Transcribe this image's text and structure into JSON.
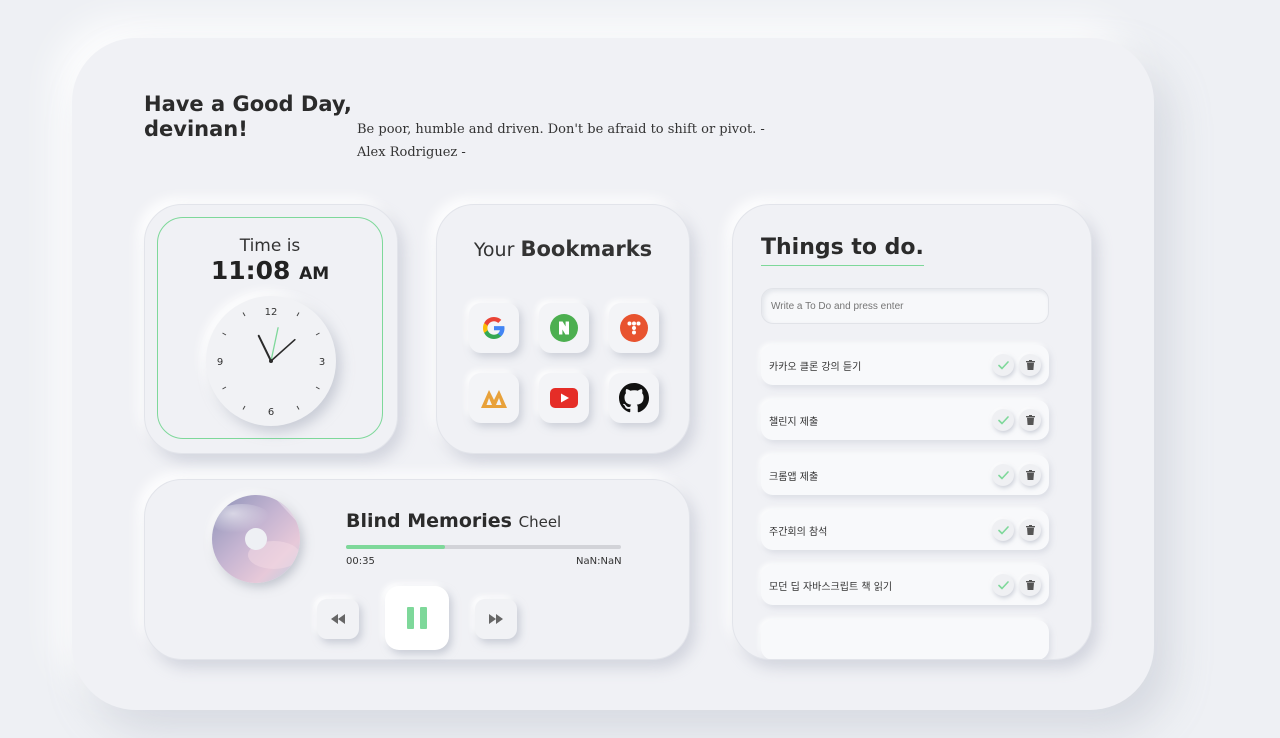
{
  "greeting": {
    "line1": "Have a Good Day,",
    "line2": "devinan!"
  },
  "quote": {
    "text": "Be poor, humble and driven. Don't be afraid to shift or pivot. - Alex Rodriguez -"
  },
  "clock": {
    "label": "Time is",
    "time": "11:08",
    "ampm": "AM",
    "numerals": [
      "12",
      "3",
      "6",
      "9"
    ],
    "hands": {
      "hour": 11,
      "minute": 8,
      "second": 2
    },
    "accent": "#7ed89a"
  },
  "bookmarks": {
    "title_prefix": "Your",
    "title_bold": "Bookmarks",
    "items": [
      {
        "name": "Google",
        "icon": "google-icon"
      },
      {
        "name": "Naver",
        "icon": "naver-icon"
      },
      {
        "name": "Toss",
        "icon": "dots-icon"
      },
      {
        "name": "Ajou",
        "icon": "mountain-icon"
      },
      {
        "name": "YouTube",
        "icon": "youtube-icon"
      },
      {
        "name": "GitHub",
        "icon": "github-icon"
      }
    ]
  },
  "music": {
    "title": "Blind Memories",
    "artist": "Cheel",
    "current_time": "00:35",
    "duration": "NaN:NaN",
    "progress": 0.36
  },
  "todo": {
    "title": "Things to do.",
    "placeholder": "Write a To Do and press enter",
    "items": [
      "카카오 클론 강의 듣기",
      "챌린지 제출",
      "크롬앱 제출",
      "주간회의 참석",
      "모던 딥 자바스크립트 책 읽기"
    ]
  },
  "colors": {
    "accent": "#7ed89a",
    "background": "#eef0f4",
    "card": "#f0f1f5"
  }
}
